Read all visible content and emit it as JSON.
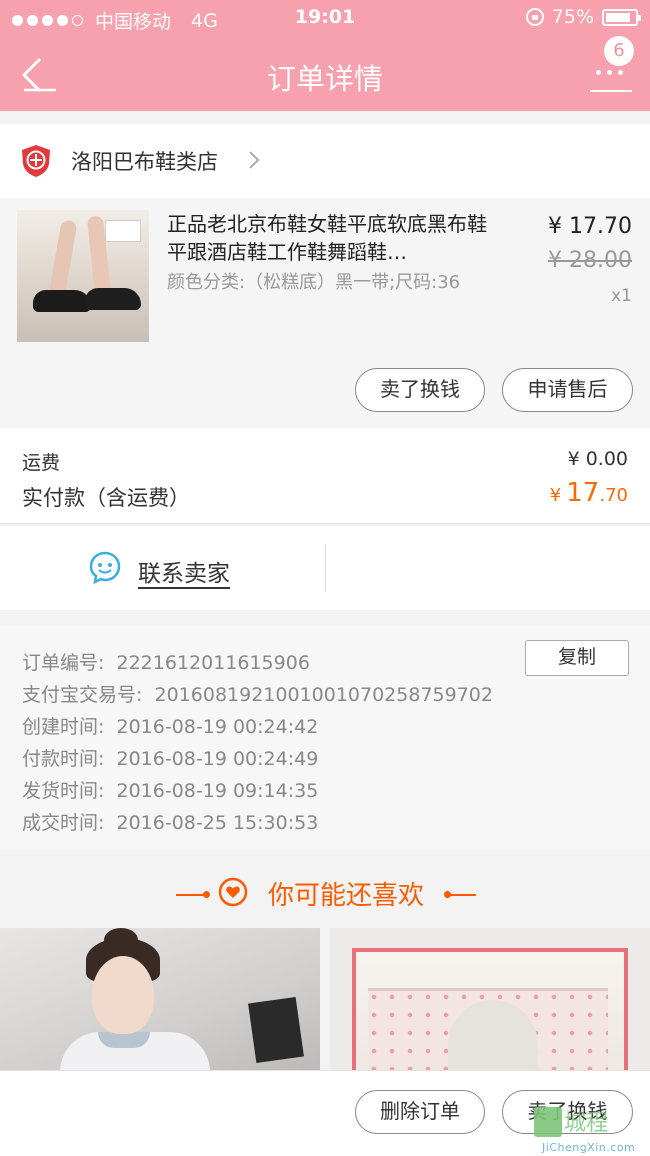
{
  "status_bar": {
    "carrier": "中国移动",
    "network": "4G",
    "time": "19:01",
    "battery": "75%"
  },
  "nav": {
    "title": "订单详情",
    "badge_count": "6"
  },
  "store": {
    "name": "洛阳巴布鞋类店"
  },
  "product": {
    "title": "正品老北京布鞋女鞋平底软底黑布鞋平跟酒店鞋工作鞋舞蹈鞋…",
    "sku": "颜色分类:（松糕底）黑一带;尺码:36",
    "price": "¥ 17.70",
    "original_price": "¥ 28.00",
    "quantity": "x1",
    "sell_button": "卖了换钱",
    "after_sale_button": "申请售后"
  },
  "totals": {
    "shipping_label": "运费",
    "shipping_value": "¥ 0.00",
    "paid_label": "实付款（含运费）",
    "paid_currency": "¥",
    "paid_integer": "17",
    "paid_decimal": ".70"
  },
  "contact": {
    "label": "联系卖家"
  },
  "order_info": {
    "copy_button": "复制",
    "lines": [
      {
        "label": "订单编号:",
        "value": "2221612011615906"
      },
      {
        "label": "支付宝交易号:",
        "value": "2016081921001001070258759702"
      },
      {
        "label": "创建时间:",
        "value": "2016-08-19 00:24:42"
      },
      {
        "label": "付款时间:",
        "value": "2016-08-19 00:24:49"
      },
      {
        "label": "发货时间:",
        "value": "2016-08-19 09:14:35"
      },
      {
        "label": "成交时间:",
        "value": "2016-08-25 15:30:53"
      }
    ]
  },
  "recommend": {
    "title": "你可能还喜欢"
  },
  "bottom_bar": {
    "delete_button": "删除订单",
    "sell_button": "卖了换钱"
  },
  "watermark": {
    "text": "城程",
    "url": "JiChengXin.com"
  },
  "colors": {
    "header_bg": "#f6a1ad",
    "accent_orange": "#ff6a00"
  }
}
